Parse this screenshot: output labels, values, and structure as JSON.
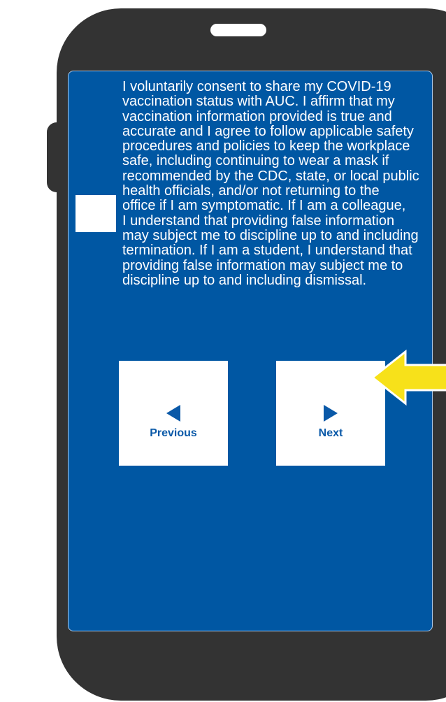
{
  "consent": {
    "text": "I voluntarily consent to share my COVID-19\nvaccination status with AUC. I affirm that my\nvaccination information provided is true and\naccurate and I agree to follow applicable safety\nprocedures and policies to keep the workplace\nsafe, including continuing to wear a mask if\nrecommended by the CDC, state, or local public\nhealth officials, and/or not returning to the\noffice if I am symptomatic. If I am a colleague,\nI understand that providing false information\nmay subject me to discipline up to and including\ntermination. If I am a student, I understand that\nproviding false information may subject me to\ndiscipline up to and including dismissal.",
    "checked": false
  },
  "navigation": {
    "previous_label": "Previous",
    "next_label": "Next"
  },
  "icons": {
    "previous": "triangle-left-icon",
    "next": "triangle-right-icon",
    "pointer": "arrow-left-icon"
  },
  "colors": {
    "screen_bg": "#0057a3",
    "phone_body": "#333333",
    "button_label": "#0a59a8",
    "pointer_arrow": "#f7e11a"
  }
}
